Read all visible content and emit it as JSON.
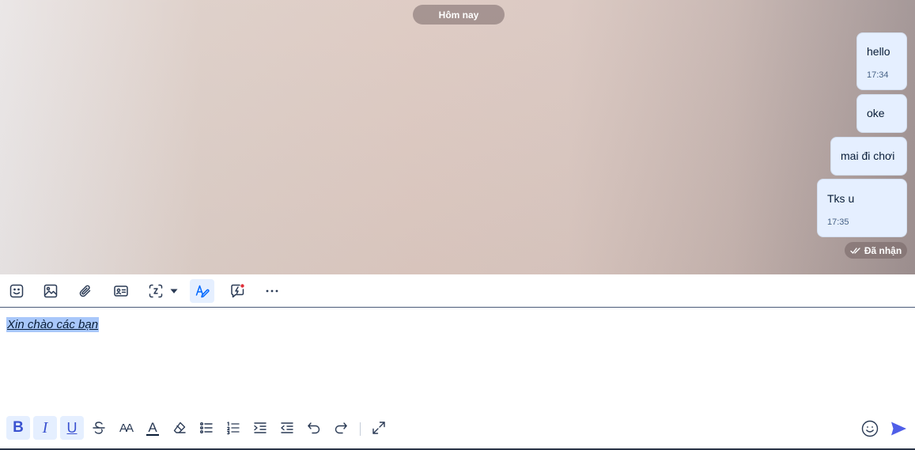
{
  "colors": {
    "accent": "#0068ff",
    "bubble": "#e5efff",
    "send": "#4f5ee8",
    "highlight": "#a8c7fa"
  },
  "chat": {
    "date_label": "Hôm nay",
    "messages": [
      {
        "text": "hello",
        "time": "17:34"
      },
      {
        "text": "oke",
        "time": ""
      },
      {
        "text": "mai đi chơi",
        "time": ""
      },
      {
        "text": "Tks u",
        "time": "17:35"
      }
    ],
    "status": "Đã nhận"
  },
  "toolbar": {
    "items": [
      "sticker-icon",
      "image-icon",
      "attachment-icon",
      "contact-card-icon",
      "screenshot-icon",
      "dropdown-caret-icon",
      "text-format-icon",
      "quick-message-icon",
      "more-icon"
    ]
  },
  "editor": {
    "text": "Xin chào các bạn"
  },
  "format_bar": {
    "bold_label": "B",
    "italic_label": "I",
    "underline_label": "U",
    "font_size_label": "AA",
    "font_color_label": "A",
    "items": [
      "bold-icon",
      "italic-icon",
      "underline-icon",
      "strikethrough-icon",
      "font-size-icon",
      "font-color-icon",
      "eraser-icon",
      "bullet-list-icon",
      "numbered-list-icon",
      "indent-icon",
      "outdent-icon",
      "undo-icon",
      "redo-icon",
      "expand-icon",
      "emoji-icon",
      "send-icon"
    ]
  }
}
